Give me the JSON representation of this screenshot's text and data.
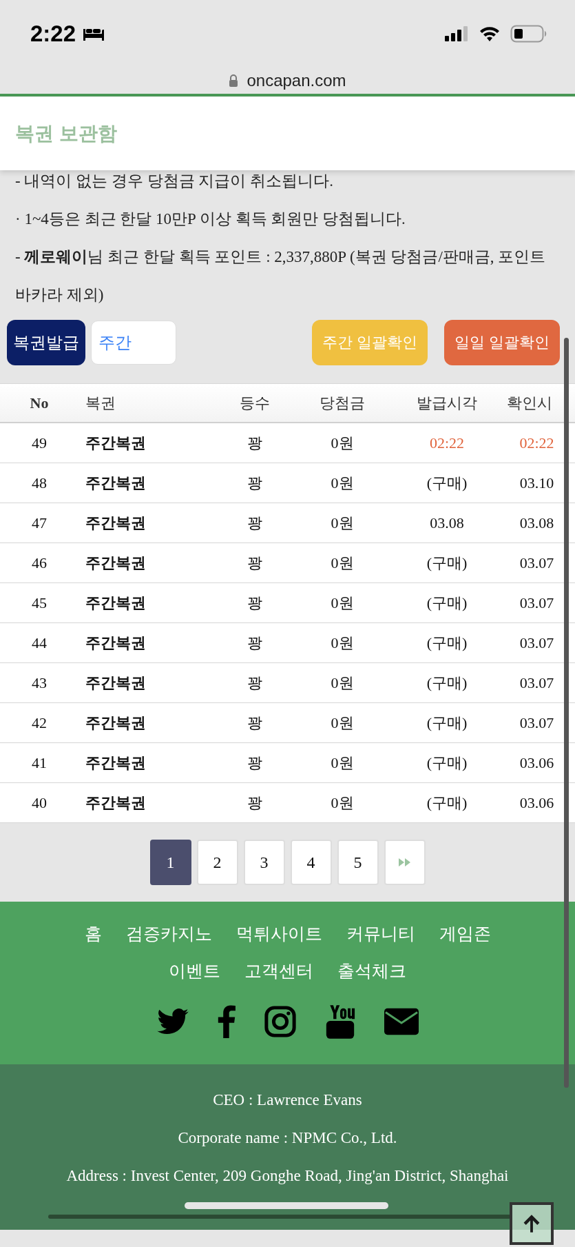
{
  "status_bar": {
    "time": "2:22"
  },
  "browser": {
    "url": "oncapan.com"
  },
  "header": {
    "title": "복권 보관함"
  },
  "notices": [
    {
      "text": "- 내역이 없는 경우 당첨금 지급이 취소됩니다."
    },
    {
      "text": "· 1~4등은 최근 한달 10만P 이상 획득 회원만 당첨됩니다."
    },
    {
      "text": "- **께로웨이**님 최근 한달 획득 포인트 : 2,337,880P (복권 당첨금/판매금, 포인트 바카라 제외)"
    }
  ],
  "toolbar": {
    "issue_button": "복권발급",
    "period_field": {
      "value": "주간"
    },
    "buttons": [
      {
        "label": "주간 일괄확인",
        "kind": "weekly"
      },
      {
        "label": "일일 일괄확인",
        "kind": "daily"
      }
    ]
  },
  "table": {
    "columns": [
      "No",
      "복권",
      "등수",
      "당첨금",
      "발급시각",
      "확인시"
    ],
    "rows": [
      {
        "cells": [
          "49",
          "주간복권",
          "꽝",
          "0원",
          "02:22",
          "02:22"
        ],
        "highlight": true
      },
      {
        "cells": [
          "48",
          "주간복권",
          "꽝",
          "0원",
          "(구매)",
          "03.10"
        ],
        "highlight": false
      },
      {
        "cells": [
          "47",
          "주간복권",
          "꽝",
          "0원",
          "03.08",
          "03.08"
        ],
        "highlight": false
      },
      {
        "cells": [
          "46",
          "주간복권",
          "꽝",
          "0원",
          "(구매)",
          "03.07"
        ],
        "highlight": false
      },
      {
        "cells": [
          "45",
          "주간복권",
          "꽝",
          "0원",
          "(구매)",
          "03.07"
        ],
        "highlight": false
      },
      {
        "cells": [
          "44",
          "주간복권",
          "꽝",
          "0원",
          "(구매)",
          "03.07"
        ],
        "highlight": false
      },
      {
        "cells": [
          "43",
          "주간복권",
          "꽝",
          "0원",
          "(구매)",
          "03.07"
        ],
        "highlight": false
      },
      {
        "cells": [
          "42",
          "주간복권",
          "꽝",
          "0원",
          "(구매)",
          "03.07"
        ],
        "highlight": false
      },
      {
        "cells": [
          "41",
          "주간복권",
          "꽝",
          "0원",
          "(구매)",
          "03.06"
        ],
        "highlight": false
      },
      {
        "cells": [
          "40",
          "주간복권",
          "꽝",
          "0원",
          "(구매)",
          "03.06"
        ],
        "highlight": false
      }
    ]
  },
  "pagination": {
    "pages": [
      {
        "label": "1",
        "selected": true
      },
      {
        "label": "2",
        "selected": false
      },
      {
        "label": "3",
        "selected": false
      },
      {
        "label": "4",
        "selected": false
      },
      {
        "label": "5",
        "selected": false
      }
    ]
  },
  "footer": {
    "links": [
      "홈",
      "검증카지노",
      "먹튀사이트",
      "커뮤니티",
      "게임존",
      "이벤트",
      "고객센터",
      "출석체크"
    ],
    "info": [
      "CEO : Lawrence Evans",
      "Corporate name : NPMC Co., Ltd.",
      "Address : Invest Center, 209 Gonghe Road, Jing'an District, Shanghai"
    ]
  }
}
